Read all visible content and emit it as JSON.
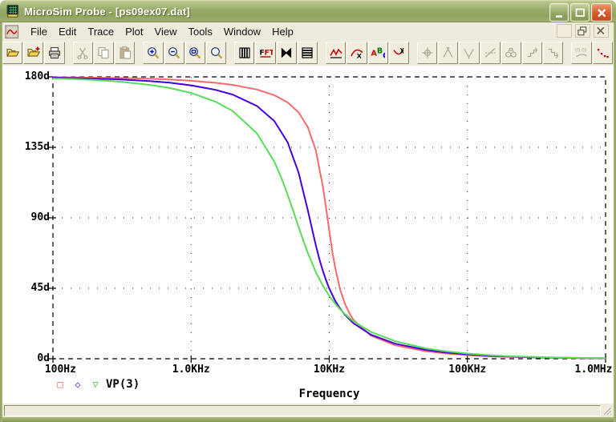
{
  "window": {
    "title": "MicroSim Probe - [ps09ex07.dat]",
    "buttons": [
      "minimize",
      "maximize",
      "close"
    ]
  },
  "menu_bar": {
    "items": [
      "File",
      "Edit",
      "Trace",
      "Plot",
      "View",
      "Tools",
      "Window",
      "Help"
    ],
    "child_controls": [
      "minimize",
      "restore",
      "close"
    ]
  },
  "toolbar": {
    "buttons": [
      {
        "name": "open-file",
        "icon": "folder",
        "enabled": true,
        "group": 1
      },
      {
        "name": "append-file",
        "icon": "folder-plus",
        "enabled": true,
        "group": 1
      },
      {
        "name": "print",
        "icon": "printer",
        "enabled": true,
        "group": 1
      },
      {
        "name": "cut",
        "icon": "scissors",
        "enabled": false,
        "group": 2
      },
      {
        "name": "copy",
        "icon": "copy",
        "enabled": false,
        "group": 2
      },
      {
        "name": "paste",
        "icon": "paste",
        "enabled": false,
        "group": 2
      },
      {
        "name": "zoom-in",
        "icon": "mag-plus",
        "enabled": true,
        "group": 3
      },
      {
        "name": "zoom-out",
        "icon": "mag-minus",
        "enabled": true,
        "group": 3
      },
      {
        "name": "zoom-area",
        "icon": "mag-rect",
        "enabled": true,
        "group": 3
      },
      {
        "name": "zoom-fit",
        "icon": "mag",
        "enabled": true,
        "group": 3
      },
      {
        "name": "log-x-axis",
        "icon": "vbars",
        "enabled": true,
        "group": 4
      },
      {
        "name": "fourier",
        "icon": "fft",
        "enabled": true,
        "group": 4
      },
      {
        "name": "performance-analysis",
        "icon": "bowtie",
        "enabled": true,
        "group": 4
      },
      {
        "name": "log-y-axis",
        "icon": "hbars",
        "enabled": true,
        "group": 4
      },
      {
        "name": "add-trace",
        "icon": "wave",
        "enabled": true,
        "group": 5
      },
      {
        "name": "eval-goal-function",
        "icon": "goal",
        "enabled": true,
        "group": 5
      },
      {
        "name": "text-label",
        "icon": "abc",
        "enabled": true,
        "group": 5
      },
      {
        "name": "insert-marker",
        "icon": "smile",
        "enabled": true,
        "group": 5
      },
      {
        "name": "cursor-toggle",
        "icon": "cursor",
        "enabled": false,
        "group": 6
      },
      {
        "name": "cursor-peak",
        "icon": "peak",
        "enabled": false,
        "group": 6
      },
      {
        "name": "cursor-trough",
        "icon": "trough",
        "enabled": false,
        "group": 6
      },
      {
        "name": "cursor-slope",
        "icon": "slope",
        "enabled": false,
        "group": 6
      },
      {
        "name": "cursor-search",
        "icon": "binoculars",
        "enabled": false,
        "group": 6
      },
      {
        "name": "cursor-next",
        "icon": "step1",
        "enabled": false,
        "group": 6
      },
      {
        "name": "cursor-transition",
        "icon": "step2",
        "enabled": false,
        "group": 6
      },
      {
        "name": "mark-point",
        "icon": "point00",
        "enabled": false,
        "group": 7
      },
      {
        "name": "mark-data-points",
        "icon": "reddots",
        "enabled": true,
        "group": 7
      }
    ]
  },
  "status_bar": {
    "text": ""
  },
  "chart_data": {
    "type": "line",
    "x_scale": "log",
    "xlabel": "Frequency",
    "xlim": [
      100,
      1000000
    ],
    "ylim": [
      0,
      180
    ],
    "x_ticks": [
      "100Hz",
      "1.0KHz",
      "10KHz",
      "100KHz",
      "1.0MHz"
    ],
    "x_tick_values": [
      100,
      1000,
      10000,
      100000,
      1000000
    ],
    "y_ticks": [
      "0d",
      "45d",
      "90d",
      "135d",
      "180d"
    ],
    "y_tick_values": [
      0,
      45,
      90,
      135,
      180
    ],
    "grid": "dotted interior at decades and 45d/90d/135d, dashed frame",
    "legend": {
      "label": "VP(3)",
      "position": "bottom-left",
      "markers": [
        {
          "shape": "square",
          "glyph": "□",
          "color": "#f06060"
        },
        {
          "shape": "diamond",
          "glyph": "◇",
          "color": "#7b2fbf"
        },
        {
          "shape": "triangle-down",
          "glyph": "▽",
          "color": "#3fcc3f"
        }
      ]
    },
    "series": [
      {
        "name": "VP(3) run 1",
        "color": "#fa6a6a",
        "f0_hz": 9700,
        "q": 2.4,
        "points": [
          [
            100,
            179.8
          ],
          [
            150,
            179.6
          ],
          [
            200,
            179.5
          ],
          [
            300,
            179.3
          ],
          [
            500,
            178.8
          ],
          [
            700,
            178.3
          ],
          [
            1000,
            177.5
          ],
          [
            1500,
            176.2
          ],
          [
            2000,
            174.9
          ],
          [
            3000,
            171.9
          ],
          [
            4000,
            168.3
          ],
          [
            5000,
            163.7
          ],
          [
            6000,
            157.3
          ],
          [
            7000,
            147.9
          ],
          [
            8000,
            133.0
          ],
          [
            9000,
            109.8
          ],
          [
            9500,
            95.7
          ],
          [
            10000,
            81.7
          ],
          [
            10500,
            69.2
          ],
          [
            11000,
            58.8
          ],
          [
            12000,
            44.2
          ],
          [
            13000,
            35.0
          ],
          [
            14000,
            29.0
          ],
          [
            15000,
            24.8
          ],
          [
            20000,
            14.8
          ],
          [
            30000,
            8.6
          ],
          [
            50000,
            4.8
          ],
          [
            70000,
            3.4
          ],
          [
            100000,
            2.3
          ],
          [
            150000,
            1.5
          ],
          [
            200000,
            1.2
          ],
          [
            300000,
            0.8
          ],
          [
            500000,
            0.5
          ],
          [
            700000,
            0.3
          ],
          [
            1000000,
            0.2
          ]
        ]
      },
      {
        "name": "VP(3) run 2",
        "color": "#4400dd",
        "f0_hz": 7200,
        "q": 1.5,
        "points": [
          [
            100,
            179.5
          ],
          [
            150,
            179.2
          ],
          [
            200,
            178.9
          ],
          [
            300,
            178.4
          ],
          [
            500,
            177.3
          ],
          [
            700,
            176.3
          ],
          [
            1000,
            174.6
          ],
          [
            1500,
            171.7
          ],
          [
            2000,
            168.7
          ],
          [
            3000,
            161.4
          ],
          [
            4000,
            151.8
          ],
          [
            5000,
            138.2
          ],
          [
            6000,
            118.8
          ],
          [
            7000,
            94.8
          ],
          [
            7500,
            83.0
          ],
          [
            8000,
            72.4
          ],
          [
            8500,
            63.4
          ],
          [
            9000,
            56.0
          ],
          [
            9500,
            49.9
          ],
          [
            10000,
            44.9
          ],
          [
            11000,
            37.3
          ],
          [
            12000,
            32.0
          ],
          [
            13000,
            28.0
          ],
          [
            15000,
            22.6
          ],
          [
            20000,
            15.4
          ],
          [
            30000,
            9.6
          ],
          [
            50000,
            5.6
          ],
          [
            70000,
            4.0
          ],
          [
            100000,
            2.8
          ],
          [
            150000,
            1.8
          ],
          [
            200000,
            1.4
          ],
          [
            300000,
            0.9
          ],
          [
            500000,
            0.6
          ],
          [
            700000,
            0.4
          ],
          [
            1000000,
            0.3
          ]
        ]
      },
      {
        "name": "VP(3) run 3",
        "color": "#58de58",
        "f0_hz": 5700,
        "q": 1.0,
        "points": [
          [
            100,
            179.0
          ],
          [
            150,
            178.5
          ],
          [
            200,
            178.0
          ],
          [
            300,
            177.0
          ],
          [
            500,
            174.9
          ],
          [
            700,
            172.9
          ],
          [
            1000,
            169.7
          ],
          [
            1500,
            164.2
          ],
          [
            2000,
            158.2
          ],
          [
            3000,
            143.9
          ],
          [
            4000,
            125.9
          ],
          [
            4500,
            115.5
          ],
          [
            5000,
            104.7
          ],
          [
            5500,
            94.1
          ],
          [
            6000,
            84.1
          ],
          [
            6500,
            75.2
          ],
          [
            7000,
            67.5
          ],
          [
            8000,
            55.3
          ],
          [
            9000,
            46.6
          ],
          [
            10000,
            40.2
          ],
          [
            11000,
            35.3
          ],
          [
            12000,
            31.5
          ],
          [
            13000,
            28.5
          ],
          [
            15000,
            23.9
          ],
          [
            20000,
            17.2
          ],
          [
            30000,
            11.2
          ],
          [
            50000,
            6.6
          ],
          [
            70000,
            4.7
          ],
          [
            100000,
            3.3
          ],
          [
            150000,
            2.2
          ],
          [
            200000,
            1.6
          ],
          [
            300000,
            1.1
          ],
          [
            500000,
            0.7
          ],
          [
            700000,
            0.5
          ],
          [
            1000000,
            0.3
          ]
        ]
      }
    ]
  }
}
